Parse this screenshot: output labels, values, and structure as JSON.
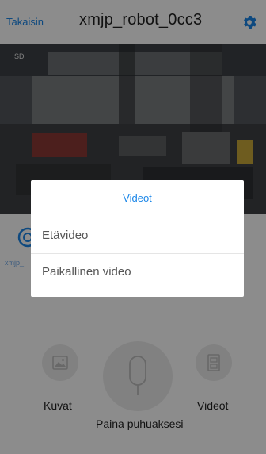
{
  "header": {
    "back_label": "Takaisin",
    "title": "xmjp_robot_0cc3",
    "settings_icon": "gear-icon"
  },
  "video": {
    "label": "SD"
  },
  "controls": {
    "camera_icon": "camera-icon",
    "side_label": "xmjp_"
  },
  "bottom": {
    "photos_label": "Kuvat",
    "videos_label": "Videot",
    "talk_label": "Paina puhuaksesi",
    "photos_icon": "image-icon",
    "videos_icon": "video-file-icon",
    "mic_icon": "microphone-icon"
  },
  "dialog": {
    "title": "Videot",
    "items": [
      "Etävideo",
      "Paikallinen video"
    ]
  }
}
